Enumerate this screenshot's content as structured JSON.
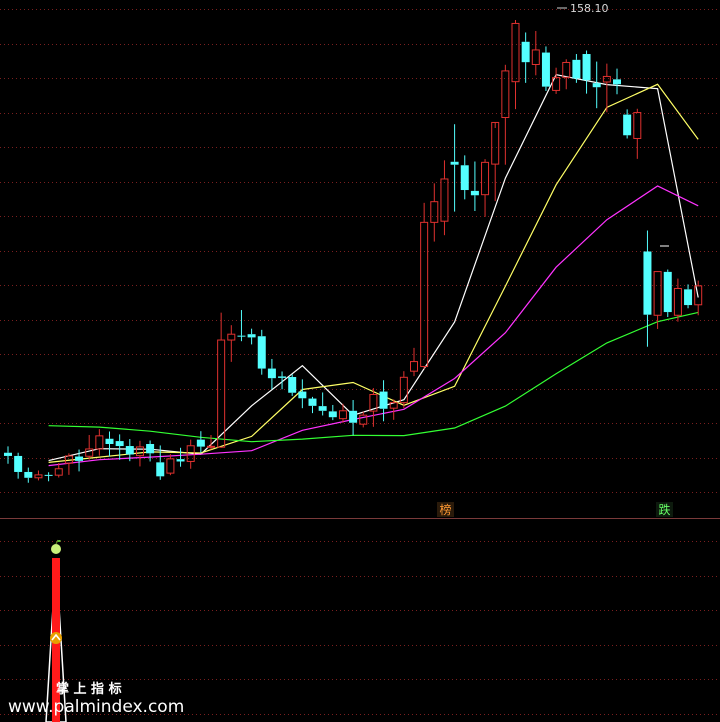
{
  "chart_data": [
    {
      "type": "candlestick",
      "title": "",
      "price_label": "158.10",
      "ylim": [
        6,
        166
      ],
      "up_color": "#e0312f",
      "down_color": "#54ffff",
      "markers": [
        "榜",
        "跌"
      ],
      "candles": [
        [
          13.3,
          15.5,
          9.5,
          12.2
        ],
        [
          12.2,
          13.3,
          4.4,
          6.7
        ],
        [
          6.7,
          8.2,
          3.0,
          4.7
        ],
        [
          4.7,
          7.2,
          3.8,
          5.7
        ],
        [
          5.7,
          6.6,
          3.5,
          5.5
        ],
        [
          5.6,
          9.8,
          4.8,
          7.8
        ],
        [
          9.7,
          13.1,
          5.7,
          12.2
        ],
        [
          12.0,
          14.4,
          6.9,
          10.5
        ],
        [
          12.1,
          19.4,
          10.9,
          14.6
        ],
        [
          14.6,
          21.4,
          12.3,
          19.1
        ],
        [
          18.1,
          20.6,
          12.0,
          16.3
        ],
        [
          17.3,
          19.6,
          10.9,
          15.6
        ],
        [
          15.6,
          18.0,
          10.4,
          12.7
        ],
        [
          12.3,
          17.4,
          8.6,
          15.3
        ],
        [
          16.3,
          17.5,
          10.3,
          13.1
        ],
        [
          10.0,
          15.8,
          4.0,
          5.2
        ],
        [
          6.3,
          12.8,
          5.6,
          11.2
        ],
        [
          11.1,
          15.0,
          8.5,
          10.3
        ],
        [
          10.3,
          17.8,
          7.8,
          15.7
        ],
        [
          17.8,
          20.7,
          13.3,
          15.4
        ],
        [
          15.4,
          19.4,
          14.4,
          15.5
        ],
        [
          15.2,
          61.4,
          15.0,
          52.0
        ],
        [
          52.0,
          57.1,
          44.5,
          54.0
        ],
        [
          53.5,
          62.3,
          51.6,
          53.3
        ],
        [
          54.0,
          55.9,
          50.5,
          52.9
        ],
        [
          53.3,
          55.5,
          40.1,
          42.2
        ],
        [
          42.2,
          45.5,
          35.1,
          38.9
        ],
        [
          39.5,
          41.2,
          35.1,
          39.0
        ],
        [
          39.3,
          40.2,
          32.8,
          33.9
        ],
        [
          34.3,
          38.5,
          28.6,
          32.0
        ],
        [
          31.9,
          32.5,
          26.9,
          29.4
        ],
        [
          29.3,
          34.0,
          26.1,
          27.7
        ],
        [
          27.5,
          29.7,
          24.5,
          25.5
        ],
        [
          25.0,
          30.1,
          23.6,
          27.7
        ],
        [
          27.7,
          31.4,
          19.3,
          23.6
        ],
        [
          23.1,
          27.4,
          22.0,
          26.2
        ],
        [
          27.6,
          35.5,
          22.2,
          33.3
        ],
        [
          34.3,
          38.2,
          24.1,
          28.4
        ],
        [
          28.6,
          31.6,
          24.6,
          30.5
        ],
        [
          30.5,
          41.3,
          28.6,
          39.2
        ],
        [
          41.3,
          49.3,
          39.6,
          44.6
        ],
        [
          42.9,
          99.1,
          42.1,
          92.4
        ],
        [
          92.4,
          105.8,
          85.8,
          99.5
        ],
        [
          92.8,
          113.7,
          88.0,
          107.3
        ],
        [
          113.2,
          126.1,
          96.1,
          112.2
        ],
        [
          112.0,
          115.4,
          100.3,
          103.5
        ],
        [
          103.2,
          113.3,
          96.3,
          101.7
        ],
        [
          101.9,
          114.1,
          94.3,
          113.0
        ],
        [
          112.4,
          124.8,
          99.7,
          126.7
        ],
        [
          128.4,
          146.5,
          112.2,
          144.4
        ],
        [
          140.7,
          161.9,
          131.3,
          160.7
        ],
        [
          154.4,
          157.6,
          140.3,
          147.4
        ],
        [
          146.6,
          158.1,
          142.9,
          151.6
        ],
        [
          150.7,
          152.8,
          137.5,
          139.0
        ],
        [
          137.7,
          145.5,
          136.5,
          142.1
        ],
        [
          142.2,
          148.4,
          138.1,
          147.3
        ],
        [
          148.2,
          150.2,
          140.3,
          141.8
        ],
        [
          150.2,
          151.4,
          136.6,
          141.2
        ],
        [
          140.2,
          147.6,
          131.6,
          138.8
        ],
        [
          140.6,
          146.9,
          130.2,
          142.5
        ],
        [
          141.5,
          145.2,
          136.4,
          139.8
        ],
        [
          129.4,
          131.2,
          121.2,
          122.3
        ],
        [
          121.2,
          131.4,
          114.2,
          130.1
        ],
        [
          82.4,
          89.6,
          49.7,
          60.7
        ],
        [
          60.5,
          75.6,
          55.8,
          75.5
        ],
        [
          75.4,
          76.2,
          59.9,
          61.6
        ],
        [
          60.5,
          73.1,
          58.3,
          69.7
        ],
        [
          69.4,
          71.1,
          62.9,
          64.0
        ],
        [
          64.1,
          72.4,
          60.5,
          70.6
        ]
      ],
      "series": [
        {
          "name": "",
          "color": "#ffffff",
          "values": [
            null,
            null,
            null,
            null,
            10.6,
            null,
            null,
            null,
            null,
            14.7,
            null,
            null,
            null,
            null,
            14.5,
            null,
            null,
            null,
            null,
            12.8,
            null,
            null,
            null,
            null,
            29.4,
            null,
            null,
            null,
            null,
            43.2,
            null,
            null,
            null,
            null,
            26.2,
            null,
            null,
            null,
            null,
            31.5,
            null,
            null,
            null,
            null,
            58.2,
            null,
            null,
            null,
            null,
            107.6,
            null,
            null,
            null,
            null,
            143.1,
            null,
            null,
            null,
            null,
            139.7,
            null,
            null,
            null,
            null,
            138.3,
            null,
            null,
            null,
            66.6
          ]
        },
        {
          "name": "",
          "color": "#ffff66",
          "values": [
            null,
            null,
            null,
            null,
            10.0,
            null,
            null,
            null,
            null,
            11.8,
            null,
            null,
            null,
            null,
            13.6,
            null,
            null,
            null,
            null,
            13.2,
            null,
            null,
            null,
            null,
            18.9,
            null,
            null,
            null,
            null,
            35.0,
            null,
            null,
            null,
            null,
            37.4,
            null,
            null,
            null,
            null,
            29.6,
            null,
            null,
            null,
            null,
            36.1,
            null,
            null,
            null,
            null,
            70.5,
            null,
            null,
            null,
            null,
            105.3,
            null,
            null,
            null,
            null,
            131.9,
            null,
            null,
            null,
            null,
            139.8,
            null,
            null,
            null,
            120.9
          ]
        },
        {
          "name": "",
          "color": "#ff33ff",
          "values": [
            null,
            null,
            null,
            null,
            8.9,
            null,
            null,
            null,
            null,
            10.9,
            null,
            null,
            null,
            null,
            11.8,
            null,
            null,
            null,
            null,
            12.8,
            null,
            null,
            null,
            null,
            14.0,
            null,
            null,
            null,
            null,
            21.0,
            null,
            null,
            null,
            null,
            24.7,
            null,
            null,
            null,
            null,
            28.2,
            null,
            null,
            null,
            null,
            38.8,
            null,
            null,
            null,
            null,
            54.5,
            null,
            null,
            null,
            null,
            77.0,
            null,
            null,
            null,
            null,
            93.3,
            null,
            null,
            null,
            null,
            104.9,
            null,
            null,
            null,
            98.1
          ]
        },
        {
          "name": "",
          "color": "#33ff33",
          "values": [
            null,
            null,
            null,
            null,
            22.6,
            null,
            null,
            null,
            null,
            22.1,
            null,
            null,
            null,
            null,
            20.7,
            null,
            null,
            null,
            null,
            18.6,
            null,
            null,
            null,
            null,
            17.1,
            null,
            null,
            null,
            null,
            18.0,
            null,
            null,
            null,
            null,
            19.3,
            null,
            null,
            null,
            null,
            19.2,
            null,
            null,
            null,
            null,
            21.8,
            null,
            null,
            null,
            null,
            29.3,
            null,
            null,
            null,
            null,
            40.4,
            null,
            null,
            null,
            null,
            51.0,
            null,
            null,
            null,
            null,
            58.3,
            null,
            null,
            null,
            61.5
          ]
        }
      ]
    },
    {
      "type": "bar",
      "title": "",
      "series": [
        {
          "name": "",
          "color": "#ff1a1a",
          "values": [
            100
          ]
        }
      ]
    }
  ],
  "watermark": {
    "brand": "掌 上 指 标",
    "url": "www.palmindex.com"
  },
  "icons": {
    "peak": "apple-icon",
    "signal": "chevron-up-icon"
  }
}
